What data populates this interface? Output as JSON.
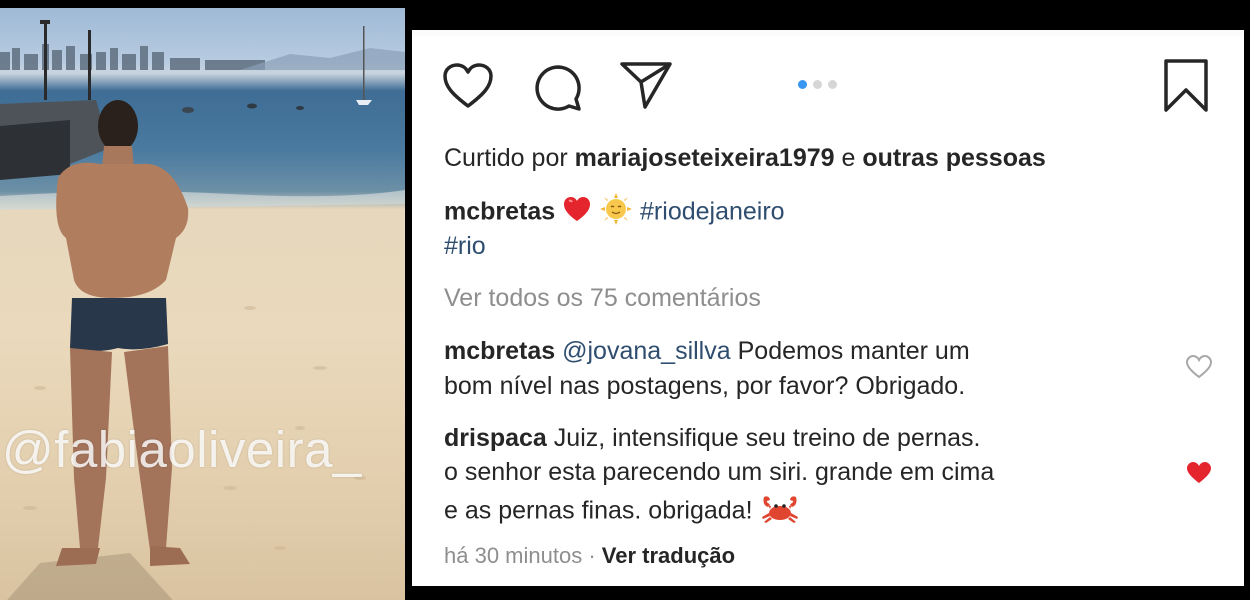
{
  "photo": {
    "watermark": "@fabiaoliveira_"
  },
  "post": {
    "carousel": {
      "count": 3,
      "active_index": 0
    },
    "likes": {
      "prefix": "Curtido por",
      "user": "mariajoseteixeira1979",
      "joiner": "e",
      "others": "outras pessoas"
    },
    "caption": {
      "user": "mcbretas",
      "emojis": [
        "heart-emoji",
        "sun-face-emoji"
      ],
      "hashtags": [
        "#riodejaneiro",
        "#rio"
      ]
    },
    "view_comments": "Ver todos os 75 comentários",
    "comments": [
      {
        "user": "mcbretas",
        "mention": "@jovana_sillva",
        "lines": [
          "Podemos manter um",
          "bom nível nas postagens, por favor? Obrigado."
        ],
        "liked": false
      },
      {
        "user": "drispaca",
        "lines": [
          "Juiz, intensifique seu treino de pernas.",
          "o senhor esta parecendo um siri. grande em cima",
          "e as pernas finas. obrigada!"
        ],
        "emoji": "crab-emoji",
        "liked": true
      }
    ],
    "timestamp": "há 30 minutos",
    "separator": "·",
    "translate": "Ver tradução"
  },
  "colors": {
    "hashtag": "#2f4d6f",
    "muted": "#8e8e8e",
    "carousel_active": "#3897f0",
    "like_red": "#ed4956"
  }
}
